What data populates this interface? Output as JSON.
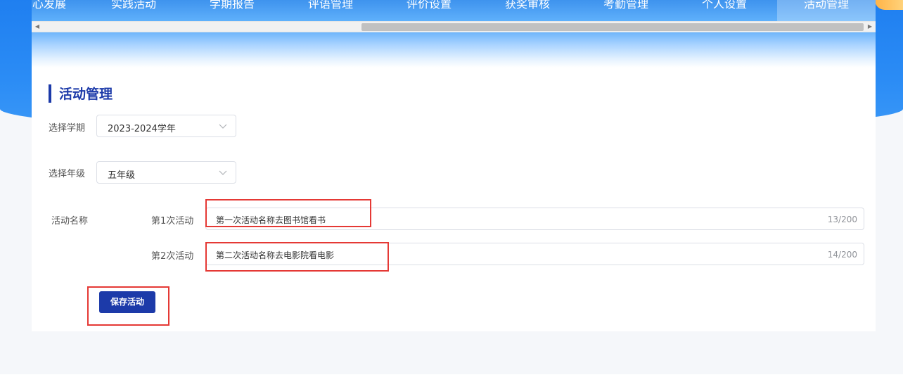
{
  "nav": {
    "items": [
      {
        "label": "心发展",
        "active": false
      },
      {
        "label": "实践活动",
        "active": false
      },
      {
        "label": "学期报告",
        "active": false
      },
      {
        "label": "评语管理",
        "active": false
      },
      {
        "label": "评价设置",
        "active": false
      },
      {
        "label": "获奖审核",
        "active": false
      },
      {
        "label": "考勤管理",
        "active": false
      },
      {
        "label": "个人设置",
        "active": false
      },
      {
        "label": "活动管理",
        "active": true
      }
    ]
  },
  "page": {
    "title": "活动管理"
  },
  "form": {
    "term_label": "选择学期",
    "term_value": "2023-2024学年",
    "grade_label": "选择年级",
    "grade_value": "五年级",
    "activity_label": "活动名称",
    "activities": [
      {
        "label": "第1次活动",
        "value": "第一次活动名称去图书馆看书",
        "count": "13/200"
      },
      {
        "label": "第2次活动",
        "value": "第二次活动名称去电影院看电影",
        "count": "14/200"
      }
    ],
    "save_label": "保存活动"
  },
  "colors": {
    "accent": "#1c3aa9",
    "header_blue": "#2b8cf5",
    "highlight": "#e53935"
  }
}
